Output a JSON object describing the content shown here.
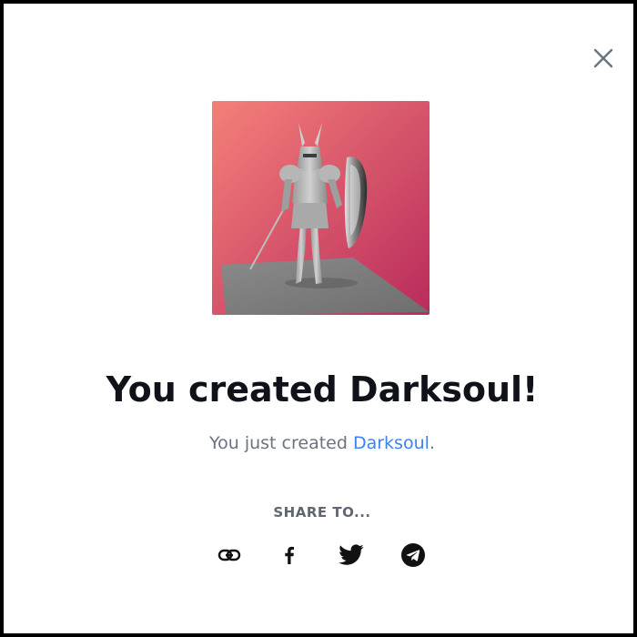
{
  "modal": {
    "close_icon": "close-icon",
    "title": "You created Darksoul!",
    "subtitle_prefix": "You just created ",
    "subtitle_link": "Darksoul",
    "subtitle_suffix": ".",
    "share_label": "SHARE TO..."
  },
  "share_buttons": [
    {
      "icon": "link-icon"
    },
    {
      "icon": "facebook-icon"
    },
    {
      "icon": "twitter-icon"
    },
    {
      "icon": "telegram-icon"
    }
  ],
  "colors": {
    "title": "#0f1219",
    "subtitle": "#6b7280",
    "link": "#3b82f6",
    "preview_gradient_start": "#f07a78",
    "preview_gradient_end": "#c0305a"
  }
}
